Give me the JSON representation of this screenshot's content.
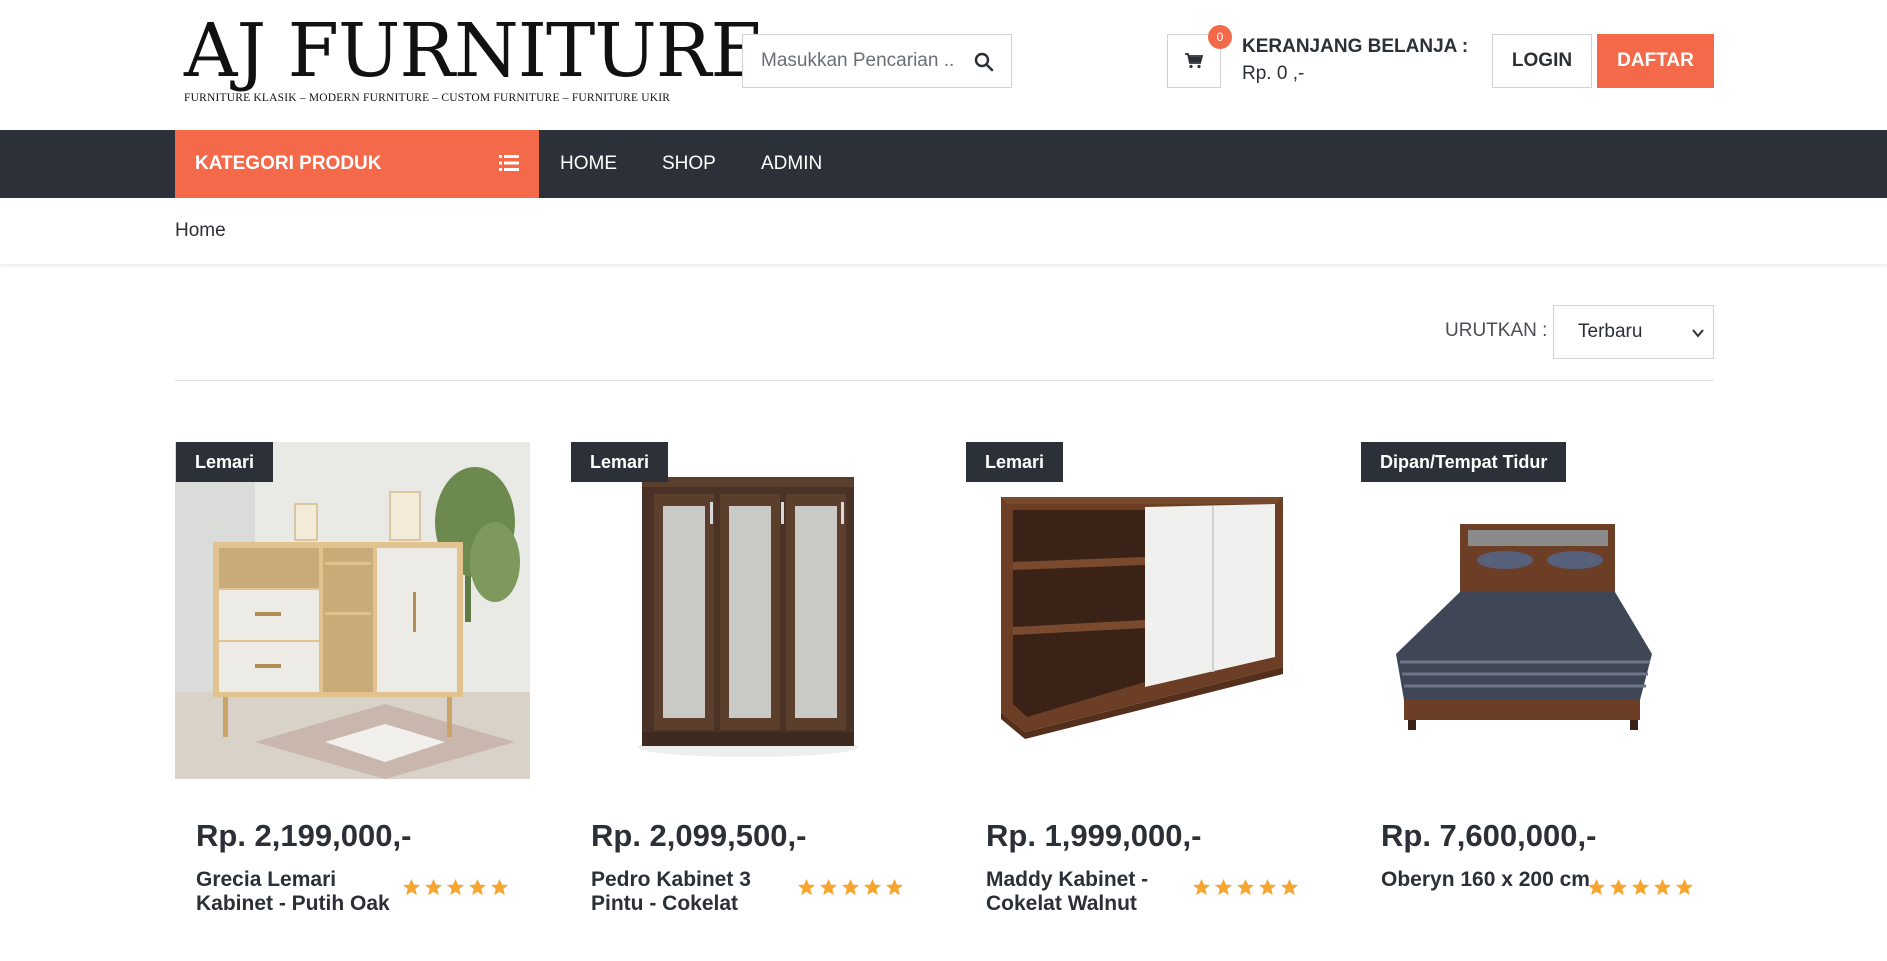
{
  "brand": {
    "title": "AJ FURNITURE",
    "subtitle": "FURNITURE KLASIK – MODERN FURNITURE – CUSTOM FURNITURE – FURNITURE UKIR"
  },
  "search": {
    "placeholder": "Masukkan Pencarian .."
  },
  "cart": {
    "count": "0",
    "label": "KERANJANG BELANJA :",
    "total": "Rp. 0 ,-"
  },
  "auth": {
    "login": "LOGIN",
    "register": "DAFTAR"
  },
  "nav": {
    "kategori": "KATEGORI PRODUK",
    "items": [
      {
        "label": "HOME"
      },
      {
        "label": "SHOP"
      },
      {
        "label": "ADMIN"
      }
    ]
  },
  "breadcrumb": {
    "home": "Home"
  },
  "sort": {
    "label": "URUTKAN :",
    "selected": "Terbaru"
  },
  "colors": {
    "accent": "#f4694a",
    "dark": "#2c3038",
    "star": "#f7a531"
  },
  "products": [
    {
      "category": "Lemari",
      "price": "Rp. 2,199,000,-",
      "name": "Grecia Lemari Kabinet - Putih Oak",
      "rating": 5
    },
    {
      "category": "Lemari",
      "price": "Rp. 2,099,500,-",
      "name": "Pedro Kabinet 3 Pintu - Cokelat",
      "rating": 5
    },
    {
      "category": "Lemari",
      "price": "Rp. 1,999,000,-",
      "name": "Maddy Kabinet - Cokelat Walnut",
      "rating": 5
    },
    {
      "category": "Dipan/Tempat Tidur",
      "price": "Rp. 7,600,000,-",
      "name": "Oberyn 160 x 200 cm",
      "rating": 5
    }
  ]
}
